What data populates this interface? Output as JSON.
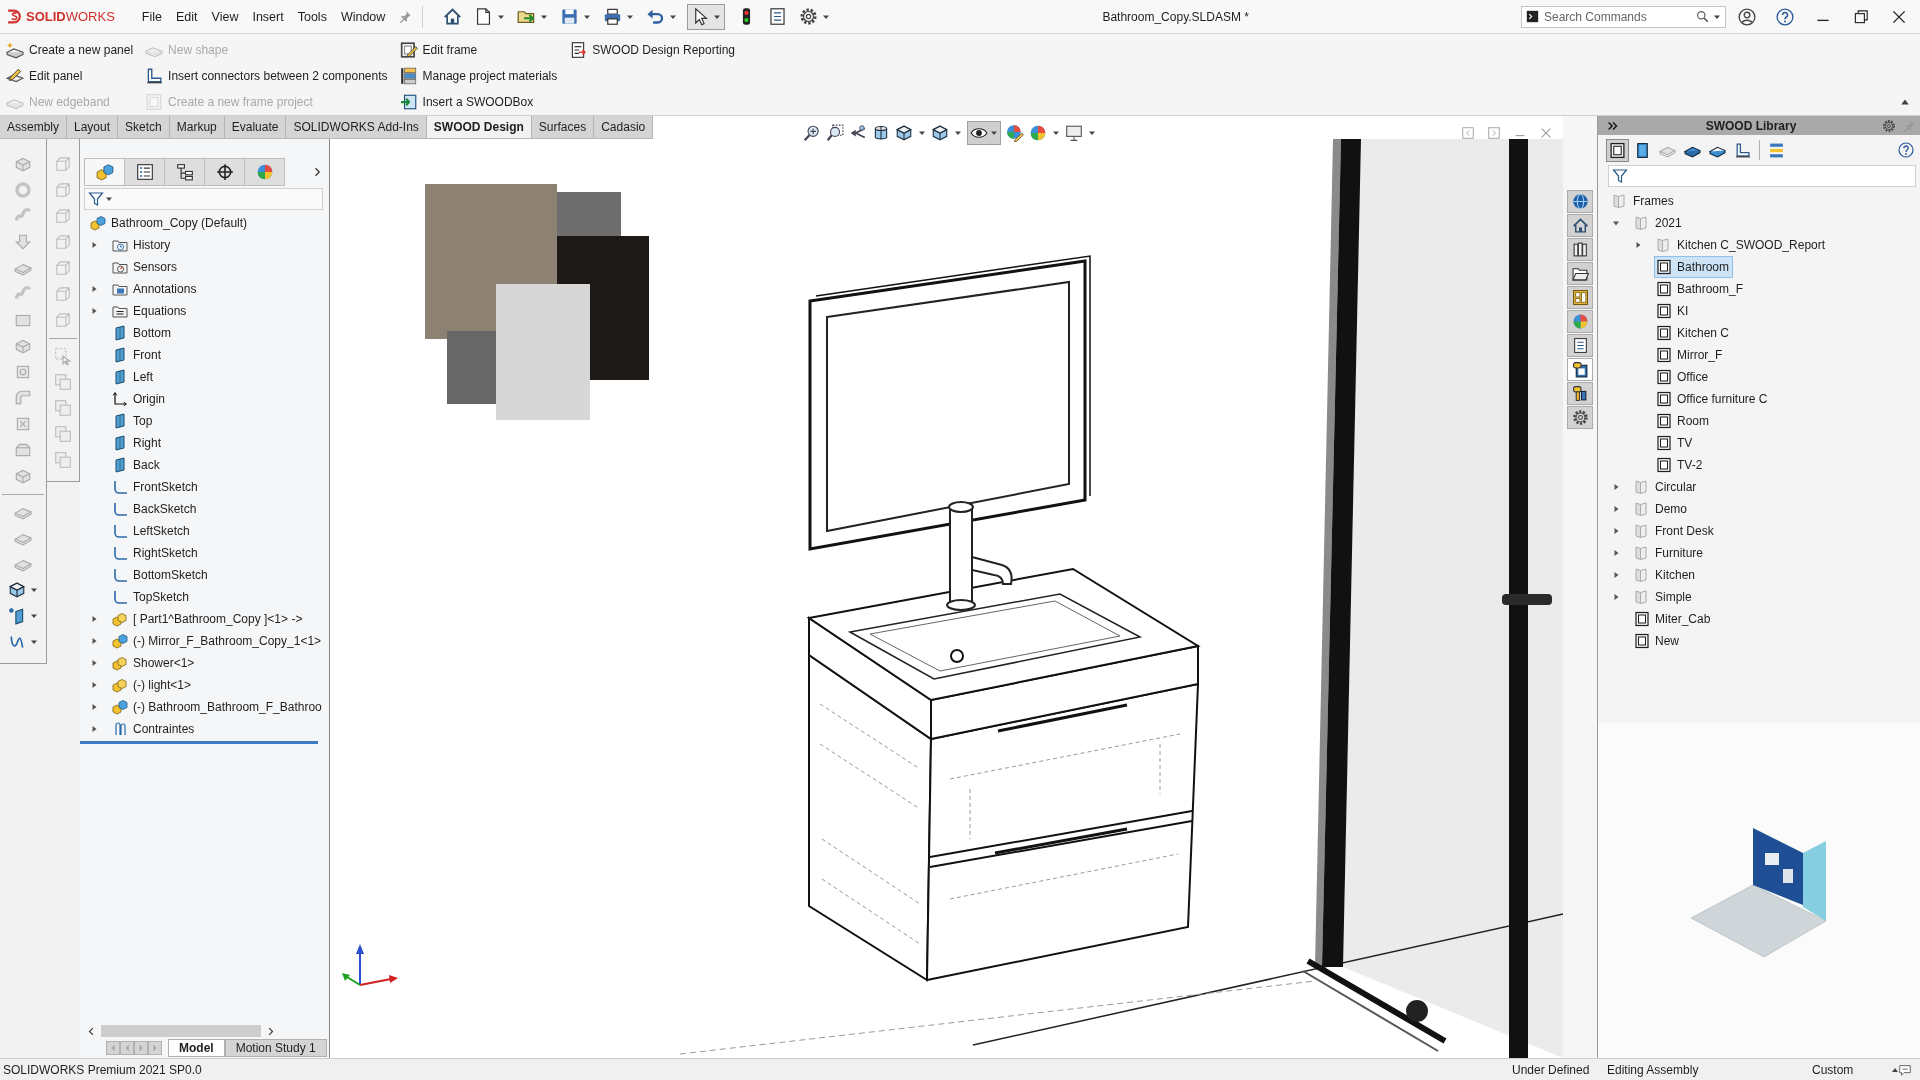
{
  "window": {
    "logo": "**SOLID**WORKS",
    "title": "Bathroom_Copy.SLDASM *"
  },
  "menu": [
    "File",
    "Edit",
    "View",
    "Insert",
    "Tools",
    "Window"
  ],
  "search": {
    "placeholder": "Search Commands"
  },
  "ribbon": {
    "columns": [
      [
        {
          "label": "Create a new panel",
          "disabled": false
        },
        {
          "label": "Edit panel",
          "disabled": false
        },
        {
          "label": "New edgeband",
          "disabled": true
        }
      ],
      [
        {
          "label": "New shape",
          "disabled": true
        },
        {
          "label": "Insert connectors between 2 components",
          "disabled": false
        },
        {
          "label": "Create a new frame project",
          "disabled": true
        }
      ],
      [
        {
          "label": "Edit frame",
          "disabled": false
        },
        {
          "label": "Manage project materials",
          "disabled": false
        },
        {
          "label": "Insert a SWOODBox",
          "disabled": false
        }
      ],
      [
        {
          "label": "SWOOD Design Reporting",
          "disabled": false
        }
      ]
    ]
  },
  "tabs": [
    {
      "label": "Assembly",
      "selected": false
    },
    {
      "label": "Layout",
      "selected": false
    },
    {
      "label": "Sketch",
      "selected": false
    },
    {
      "label": "Markup",
      "selected": false
    },
    {
      "label": "Evaluate",
      "selected": false
    },
    {
      "label": "SOLIDWORKS Add-Ins",
      "selected": false
    },
    {
      "label": "SWOOD Design",
      "selected": true
    },
    {
      "label": "Surfaces",
      "selected": false
    },
    {
      "label": "Cadasio",
      "selected": false
    }
  ],
  "feature_manager": {
    "tabs": [
      {
        "selected": true
      },
      {
        "selected": false
      },
      {
        "selected": false
      },
      {
        "selected": false
      },
      {
        "selected": false
      }
    ],
    "tree": {
      "label": "Bathroom_Copy (Default)",
      "kind": "assembly",
      "selected": false,
      "children": [
        {
          "label": "History",
          "kind": "history",
          "expanded": false,
          "selected": false
        },
        {
          "label": "Sensors",
          "kind": "sensors",
          "selected": false
        },
        {
          "label": "Annotations",
          "kind": "annotations",
          "expanded": false,
          "selected": false
        },
        {
          "label": "Equations",
          "kind": "equations",
          "expanded": false,
          "selected": false
        },
        {
          "label": "Bottom",
          "kind": "plane",
          "selected": false
        },
        {
          "label": "Front",
          "kind": "plane",
          "selected": false
        },
        {
          "label": "Left",
          "kind": "plane",
          "selected": false
        },
        {
          "label": "Origin",
          "kind": "origin",
          "selected": false
        },
        {
          "label": "Top",
          "kind": "plane",
          "selected": false
        },
        {
          "label": "Right",
          "kind": "plane",
          "selected": false
        },
        {
          "label": "Back",
          "kind": "plane",
          "selected": false
        },
        {
          "label": "FrontSketch",
          "kind": "sketch",
          "selected": false
        },
        {
          "label": "BackSketch",
          "kind": "sketch",
          "selected": false
        },
        {
          "label": "LeftSketch",
          "kind": "sketch",
          "selected": false
        },
        {
          "label": "RightSketch",
          "kind": "sketch",
          "selected": false
        },
        {
          "label": "BottomSketch",
          "kind": "sketch",
          "selected": false
        },
        {
          "label": "TopSketch",
          "kind": "sketch",
          "selected": false
        },
        {
          "label": "[ Part1^Bathroom_Copy ]<1> ->",
          "kind": "part",
          "expanded": false,
          "selected": false
        },
        {
          "label": "(-) Mirror_F_Bathroom_Copy_1<1>",
          "kind": "subassembly",
          "expanded": false,
          "selected": false
        },
        {
          "label": "Shower<1>",
          "kind": "part",
          "expanded": false,
          "selected": false
        },
        {
          "label": "(-) light<1>",
          "kind": "part",
          "expanded": false,
          "selected": false
        },
        {
          "label": "(-) Bathroom_Bathroom_F_Bathroo",
          "kind": "subassembly",
          "expanded": false,
          "selected": false
        },
        {
          "label": "Contraintes",
          "kind": "mates",
          "expanded": false,
          "selected": false
        }
      ]
    }
  },
  "bottom_tabs": [
    {
      "label": "Model",
      "selected": true
    },
    {
      "label": "Motion Study 1",
      "selected": false
    }
  ],
  "task_pane": {
    "tabs": [
      {
        "selected": false
      },
      {
        "selected": false
      },
      {
        "selected": false
      },
      {
        "selected": false
      },
      {
        "selected": false
      },
      {
        "selected": false
      },
      {
        "selected": false
      },
      {
        "selected": true
      },
      {
        "selected": false
      },
      {
        "selected": false
      }
    ]
  },
  "library": {
    "title": "SWOOD Library",
    "tools": [
      {
        "selected": true
      },
      {
        "selected": false
      },
      {
        "selected": false
      },
      {
        "selected": false
      },
      {
        "selected": false
      },
      {
        "selected": false
      },
      {
        "selected": false
      }
    ],
    "tree": {
      "label": "Frames",
      "kind": "folder",
      "selected": false,
      "children": [
        {
          "label": "2021",
          "kind": "folder",
          "expanded": true,
          "selected": false,
          "children": [
            {
              "label": "Kitchen C_SWOOD_Report",
              "kind": "folder",
              "expanded": false,
              "selected": false
            },
            {
              "label": "Bathroom",
              "kind": "frame",
              "selected": true
            },
            {
              "label": "Bathroom_F",
              "kind": "frame",
              "selected": false
            },
            {
              "label": "KI",
              "kind": "frame",
              "selected": false
            },
            {
              "label": "Kitchen C",
              "kind": "frame",
              "selected": false
            },
            {
              "label": "Mirror_F",
              "kind": "frame",
              "selected": false
            },
            {
              "label": "Office",
              "kind": "frame",
              "selected": false
            },
            {
              "label": "Office furniture C",
              "kind": "frame",
              "selected": false
            },
            {
              "label": "Room",
              "kind": "frame",
              "selected": false
            },
            {
              "label": "TV",
              "kind": "frame",
              "selected": false
            },
            {
              "label": "TV-2",
              "kind": "frame",
              "selected": false
            }
          ]
        },
        {
          "label": "Circular",
          "kind": "folder",
          "expanded": false,
          "selected": false
        },
        {
          "label": "Demo",
          "kind": "folder",
          "expanded": false,
          "selected": false
        },
        {
          "label": "Front Desk",
          "kind": "folder",
          "expanded": false,
          "selected": false
        },
        {
          "label": "Furniture",
          "kind": "folder",
          "expanded": false,
          "selected": false
        },
        {
          "label": "Kitchen",
          "kind": "folder",
          "expanded": false,
          "selected": false
        },
        {
          "label": "Simple",
          "kind": "folder",
          "expanded": false,
          "selected": false
        },
        {
          "label": "Miter_Cab",
          "kind": "frame",
          "selected": false
        },
        {
          "label": "New",
          "kind": "frame",
          "selected": false
        }
      ]
    }
  },
  "status_bar": {
    "version": "SOLIDWORKS Premium 2021 SP0.0",
    "state": "Under Defined",
    "mode": "Editing Assembly",
    "units": "Custom"
  }
}
